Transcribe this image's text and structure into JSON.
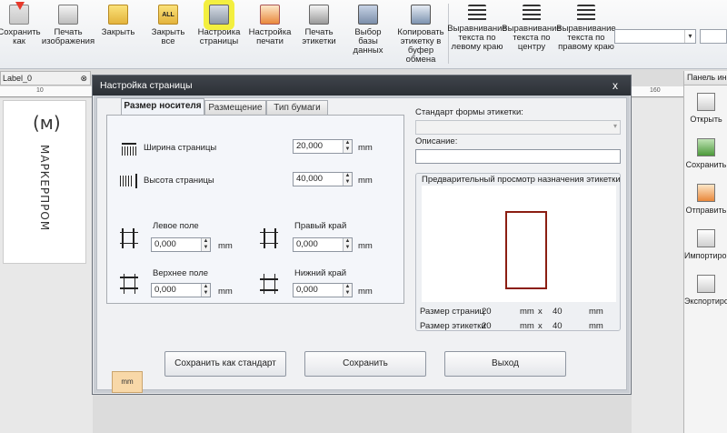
{
  "toolbar": {
    "buttons": [
      {
        "label": "Сохранить как",
        "icon": "save-as-icon"
      },
      {
        "label": "Печать изображения",
        "icon": "print-image-icon"
      },
      {
        "label": "Закрыть",
        "icon": "folder-close-icon"
      },
      {
        "label": "Закрыть все",
        "icon": "close-all-icon"
      },
      {
        "label": "Настройка страницы",
        "icon": "page-setup-icon"
      },
      {
        "label": "Настройка печати",
        "icon": "print-setup-icon"
      },
      {
        "label": "Печать этикетки",
        "icon": "print-label-icon"
      },
      {
        "label": "Выбор базы данных",
        "icon": "database-select-icon"
      },
      {
        "label": "Копировать этикетку в буфер обмена",
        "icon": "copy-clipboard-icon"
      },
      {
        "label": "Выравнивание текста по левому краю",
        "icon": "align-left-icon"
      },
      {
        "label": "Выравнивание текста по центру",
        "icon": "align-center-icon"
      },
      {
        "label": "Выравнивание текста по правому краю",
        "icon": "align-right-icon"
      }
    ],
    "font_combo": "",
    "size_combo": ""
  },
  "document_tab": {
    "label": "Label_0"
  },
  "ruler": {
    "h_left": "10",
    "h_right": "160"
  },
  "label_preview_logo": {
    "mark": "(ᴍ)",
    "text": "МАРКЕРПРОМ"
  },
  "right_panel": {
    "title": "Панель инструментов",
    "items": [
      {
        "label": "Открыть",
        "icon": "open-icon"
      },
      {
        "label": "Сохранить",
        "icon": "save-icon"
      },
      {
        "label": "Отправить",
        "icon": "send-icon"
      },
      {
        "label": "Импортировать",
        "icon": "import-icon"
      },
      {
        "label": "Экспортировать",
        "icon": "export-icon"
      }
    ]
  },
  "dialog": {
    "title": "Настройка страницы",
    "close": "x",
    "tabs": [
      "Размер носителя",
      "Размещение",
      "Тип бумаги"
    ],
    "page_width": {
      "label": "Ширина страницы",
      "value": "20,000",
      "unit": "mm"
    },
    "page_height": {
      "label": "Высота страницы",
      "value": "40,000",
      "unit": "mm"
    },
    "left_margin": {
      "label": "Левое поле",
      "value": "0,000",
      "unit": "mm"
    },
    "right_margin": {
      "label": "Правый край",
      "value": "0,000",
      "unit": "mm"
    },
    "top_margin": {
      "label": "Верхнее поле",
      "value": "0,000",
      "unit": "mm"
    },
    "bottom_margin": {
      "label": "Нижний край",
      "value": "0,000",
      "unit": "mm"
    },
    "standard_label": "Стандарт формы этикетки:",
    "standard_value": "",
    "description_label": "Описание:",
    "description_value": "",
    "preview_title": "Предварительный просмотр назначения этикетки",
    "page_size": {
      "label": "Размер страниц",
      "w": "20",
      "unit1": "mm",
      "x": "x",
      "h": "40",
      "unit2": "mm"
    },
    "label_size": {
      "label": "Размер этикетки",
      "w": "20",
      "unit1": "mm",
      "x": "x",
      "h": "40",
      "unit2": "mm"
    },
    "mm_badge": "mm",
    "buttons": {
      "save_standard": "Сохранить как стандарт",
      "save": "Сохранить",
      "exit": "Выход"
    }
  }
}
